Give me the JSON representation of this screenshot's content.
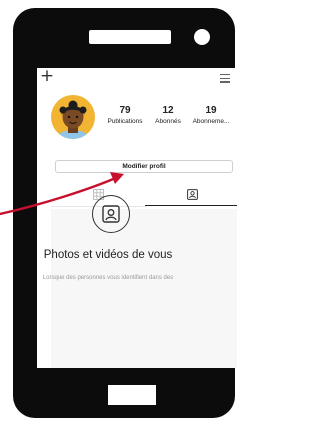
{
  "colors": {
    "phone_body": "#0c0c0c",
    "avatar_bg": "#f2b533",
    "arrow": "#c8102e"
  },
  "header": {
    "left_icon": "plus-icon",
    "right_icon": "hamburger-menu-icon"
  },
  "profile": {
    "stats": [
      {
        "value": "79",
        "label": "Publications"
      },
      {
        "value": "12",
        "label": "Abonnés"
      },
      {
        "value": "19",
        "label": "Abonneme..."
      }
    ],
    "edit_button_label": "Modifier profil"
  },
  "tabs": [
    {
      "icon": "grid-icon",
      "active": false
    },
    {
      "icon": "tagged-person-icon",
      "active": true
    }
  ],
  "empty_state": {
    "icon": "tagged-person-circle-icon",
    "title": "Photos et vidéos de vous",
    "subtitle": "Lorsque des personnes vous identifient dans des"
  }
}
